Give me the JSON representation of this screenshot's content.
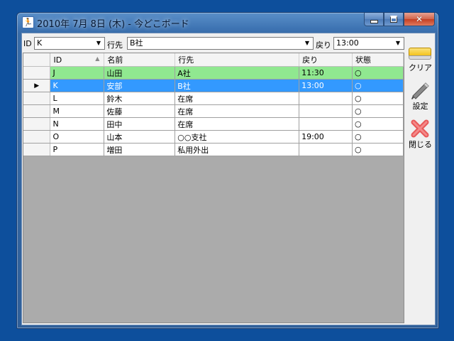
{
  "window": {
    "title": "2010年 7月 8日 (木) - 今どこボード",
    "app_icon": "running-man-icon"
  },
  "caption_buttons": {
    "minimize": "minimize-icon",
    "maximize": "maximize-icon",
    "close": "close-icon"
  },
  "filter": {
    "id_label": "ID",
    "id_value": "K",
    "dest_label": "行先",
    "dest_value": "B社",
    "return_label": "戻り",
    "return_value": "13:00"
  },
  "grid": {
    "columns": [
      "ID",
      "名前",
      "行先",
      "戻り",
      "状態"
    ],
    "rows": [
      {
        "id": "J",
        "name": "山田",
        "dest": "A社",
        "ret": "11:30",
        "status": "○"
      },
      {
        "id": "K",
        "name": "安部",
        "dest": "B社",
        "ret": "13:00",
        "status": "○"
      },
      {
        "id": "L",
        "name": "鈴木",
        "dest": "在席",
        "ret": "",
        "status": "○"
      },
      {
        "id": "M",
        "name": "佐藤",
        "dest": "在席",
        "ret": "",
        "status": "○"
      },
      {
        "id": "N",
        "name": "田中",
        "dest": "在席",
        "ret": "",
        "status": "○"
      },
      {
        "id": "O",
        "name": "山本",
        "dest": "○○支社",
        "ret": "19:00",
        "status": "○"
      },
      {
        "id": "P",
        "name": "増田",
        "dest": "私用外出",
        "ret": "",
        "status": "○"
      }
    ],
    "current_row_marker": "▶"
  },
  "toolbar": {
    "clear_label": "クリア",
    "settings_label": "設定",
    "close_label": "閉じる"
  },
  "colors": {
    "selected_row": "#3399ff",
    "highlight_row": "#90e890",
    "grid_background": "#ababab"
  }
}
